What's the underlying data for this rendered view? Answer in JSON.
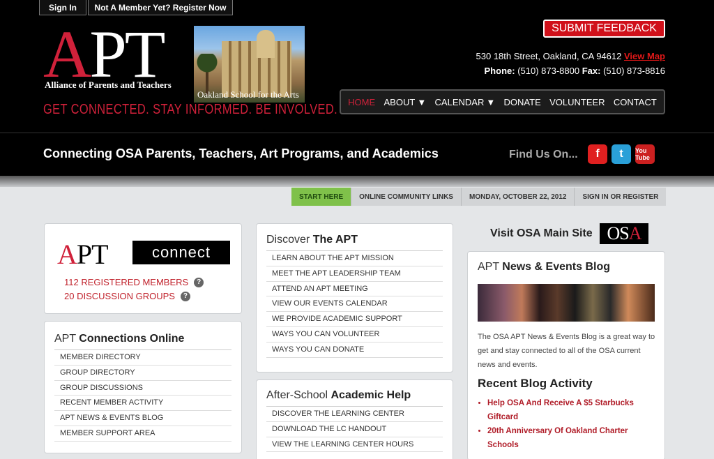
{
  "top": {
    "signin": "Sign In",
    "register": "Not A Member Yet? Register Now"
  },
  "logo": {
    "big_a": "A",
    "big_rest": "PT",
    "subtitle": "Alliance of Parents and Teachers",
    "school": "Oakland School for the Arts",
    "tagline": "GET CONNECTED. STAY INFORMED. BE INVOLVED."
  },
  "feedback": "SUBMIT FEEDBACK",
  "contact": {
    "address": "530 18th Street, Oakland, CA 94612",
    "viewmap": "View Map",
    "phone_label": "Phone:",
    "phone": "(510) 873-8800",
    "fax_label": "Fax:",
    "fax": "(510) 873-8816"
  },
  "nav": {
    "home": "HOME",
    "about": "ABOUT",
    "calendar": "CALENDAR",
    "donate": "DONATE",
    "volunteer": "VOLUNTEER",
    "contact": "CONTACT"
  },
  "band": {
    "slogan": "Connecting OSA Parents, Teachers, Art Programs, and Academics",
    "findus": "Find Us On...",
    "facebook": "f",
    "twitter": "t",
    "youtube": "You Tube"
  },
  "tabs": {
    "start": "START HERE",
    "links": "ONLINE COMMUNITY LINKS",
    "date": "MONDAY, OCTOBER 22, 2012",
    "signin": "SIGN IN OR REGISTER"
  },
  "aptconnect": {
    "logo_a": "A",
    "logo_rest": "PT",
    "connect": "connect",
    "members": "112 REGISTERED MEMBERS",
    "groups": "20 DISCUSSION GROUPS",
    "help": "?"
  },
  "connections": {
    "title_pre": "APT ",
    "title_bold": "Connections Online",
    "items": [
      "MEMBER DIRECTORY",
      "GROUP DIRECTORY",
      "GROUP DISCUSSIONS",
      "RECENT MEMBER ACTIVITY",
      "APT NEWS & EVENTS BLOG",
      "MEMBER SUPPORT AREA"
    ]
  },
  "discover": {
    "title_pre": "Discover ",
    "title_bold": "The APT",
    "items": [
      "LEARN ABOUT THE APT MISSION",
      "MEET THE APT LEADERSHIP TEAM",
      "ATTEND AN APT MEETING",
      "VIEW OUR EVENTS CALENDAR",
      "WE PROVIDE ACADEMIC SUPPORT",
      "WAYS YOU CAN VOLUNTEER",
      "WAYS YOU CAN DONATE"
    ]
  },
  "afterschool": {
    "title_pre": "After-School ",
    "title_bold": "Academic Help",
    "items": [
      "DISCOVER THE LEARNING CENTER",
      "DOWNLOAD THE LC HANDOUT",
      "VIEW THE LEARNING CENTER HOURS"
    ]
  },
  "visit": {
    "label": "Visit OSA Main Site",
    "osa_o": "O",
    "osa_s": "S",
    "osa_a": "A"
  },
  "blog": {
    "title_pre": "APT ",
    "title_bold": "News & Events Blog",
    "text": "The OSA APT News & Events Blog is a great way to get and stay connected to all of the OSA current news and events.",
    "recent": "Recent Blog Activity",
    "posts": [
      "Help OSA And Receive A $5 Starbucks Giftcard",
      "20th Anniversary Of Oakland Charter Schools"
    ]
  },
  "colors": {
    "brand_red": "#d0213a",
    "start_green": "#7fc14a"
  }
}
